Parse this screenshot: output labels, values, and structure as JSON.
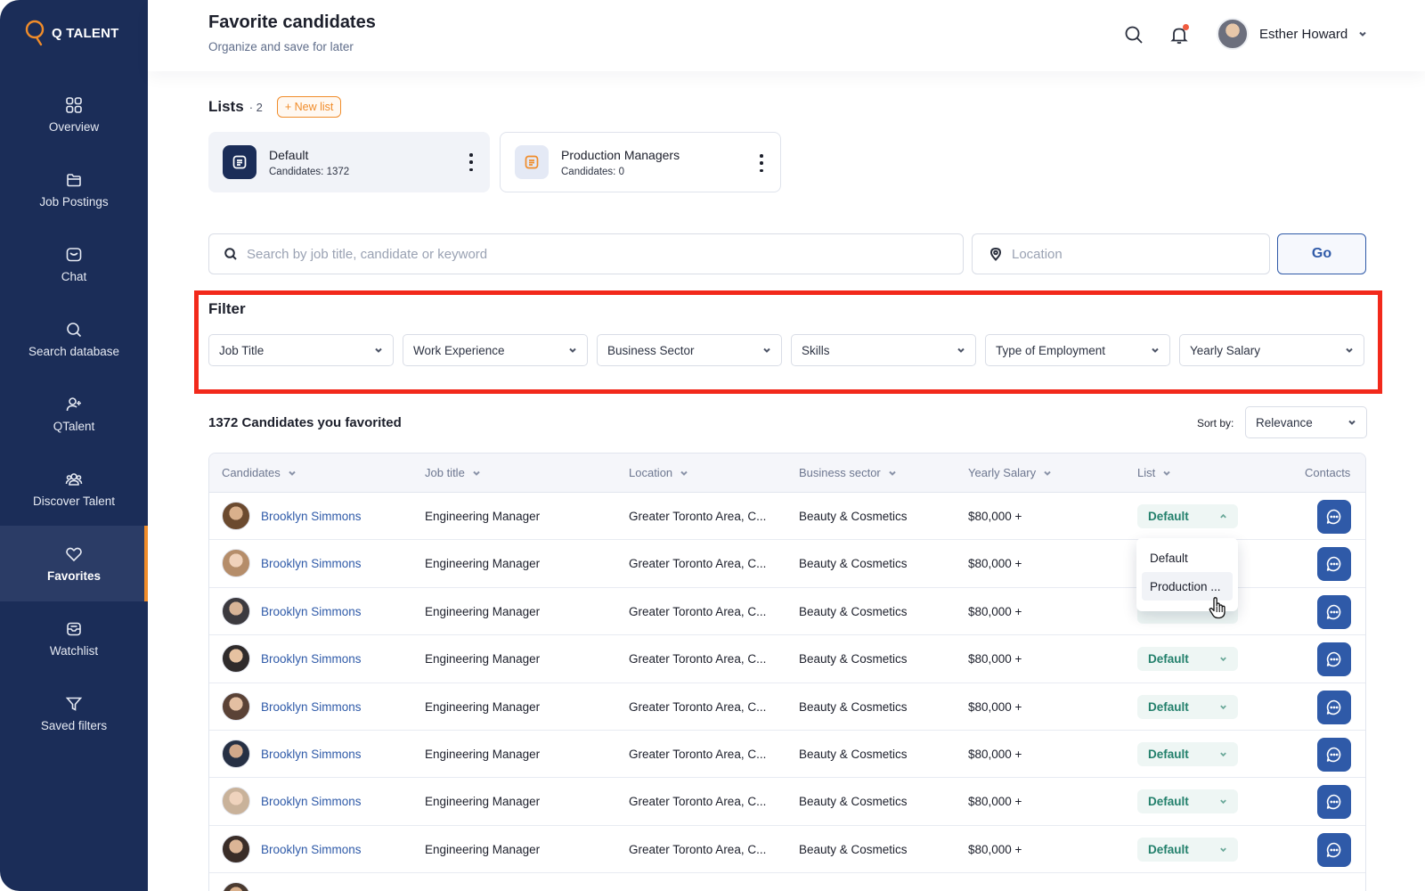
{
  "app": {
    "brand": "Q TALENT"
  },
  "sidebar": {
    "items": [
      {
        "label": "Overview",
        "icon": "grid-icon"
      },
      {
        "label": "Job Postings",
        "icon": "folder-icon"
      },
      {
        "label": "Chat",
        "icon": "chat-icon"
      },
      {
        "label": "Search database",
        "icon": "search-icon"
      },
      {
        "label": "QTalent",
        "icon": "user-plus-icon"
      },
      {
        "label": "Discover Talent",
        "icon": "users-icon"
      },
      {
        "label": "Favorites",
        "icon": "heart-icon",
        "active": true
      },
      {
        "label": "Watchlist",
        "icon": "inbox-icon"
      },
      {
        "label": "Saved filters",
        "icon": "filter-icon"
      }
    ]
  },
  "header": {
    "title": "Favorite candidates",
    "subtitle": "Organize and save for later",
    "user_name": "Esther Howard"
  },
  "lists": {
    "title": "Lists",
    "count": "· 2",
    "new_list_label": "+ New list",
    "cards": [
      {
        "name": "Default",
        "candidates": "Candidates: 1372"
      },
      {
        "name": "Production Managers",
        "candidates": "Candidates: 0"
      }
    ]
  },
  "search": {
    "placeholder": "Search by job title, candidate or keyword",
    "value": "",
    "location_placeholder": "Location",
    "location_value": "",
    "go_label": "Go"
  },
  "filter": {
    "title": "Filter",
    "dropdowns": [
      "Job Title",
      "Work Experience",
      "Business Sector",
      "Skills",
      "Type of Employment",
      "Yearly Salary"
    ]
  },
  "results": {
    "title": "1372 Candidates you favorited",
    "sort_label": "Sort by:",
    "sort_value": "Relevance"
  },
  "table": {
    "columns": [
      "Candidates",
      "Job title",
      "Location",
      "Business sector",
      "Yearly Salary",
      "List",
      "Contacts"
    ],
    "rows": [
      {
        "name": "Brooklyn Simmons",
        "job": "Engineering Manager",
        "location": "Greater Toronto Area, C...",
        "sector": "Beauty & Cosmetics",
        "salary": "$80,000 +",
        "list": "Default"
      },
      {
        "name": "Brooklyn Simmons",
        "job": "Engineering Manager",
        "location": "Greater Toronto Area, C...",
        "sector": "Beauty & Cosmetics",
        "salary": "$80,000 +",
        "list": ""
      },
      {
        "name": "Brooklyn Simmons",
        "job": "Engineering Manager",
        "location": "Greater Toronto Area, C...",
        "sector": "Beauty & Cosmetics",
        "salary": "$80,000 +",
        "list": ""
      },
      {
        "name": "Brooklyn Simmons",
        "job": "Engineering Manager",
        "location": "Greater Toronto Area, C...",
        "sector": "Beauty & Cosmetics",
        "salary": "$80,000 +",
        "list": "Default"
      },
      {
        "name": "Brooklyn Simmons",
        "job": "Engineering Manager",
        "location": "Greater Toronto Area, C...",
        "sector": "Beauty & Cosmetics",
        "salary": "$80,000 +",
        "list": "Default"
      },
      {
        "name": "Brooklyn Simmons",
        "job": "Engineering Manager",
        "location": "Greater Toronto Area, C...",
        "sector": "Beauty & Cosmetics",
        "salary": "$80,000 +",
        "list": "Default"
      },
      {
        "name": "Brooklyn Simmons",
        "job": "Engineering Manager",
        "location": "Greater Toronto Area, C...",
        "sector": "Beauty & Cosmetics",
        "salary": "$80,000 +",
        "list": "Default"
      },
      {
        "name": "Brooklyn Simmons",
        "job": "Engineering Manager",
        "location": "Greater Toronto Area, C...",
        "sector": "Beauty & Cosmetics",
        "salary": "$80,000 +",
        "list": "Default"
      }
    ]
  },
  "list_dropdown": {
    "options": [
      "Default",
      "Production ..."
    ]
  },
  "colors": {
    "sidebar": "#1b2d58",
    "accent": "#f08c2a",
    "primary": "#2f5aa8",
    "highlight": "#f2291b",
    "list_pill_text": "#23806c"
  }
}
